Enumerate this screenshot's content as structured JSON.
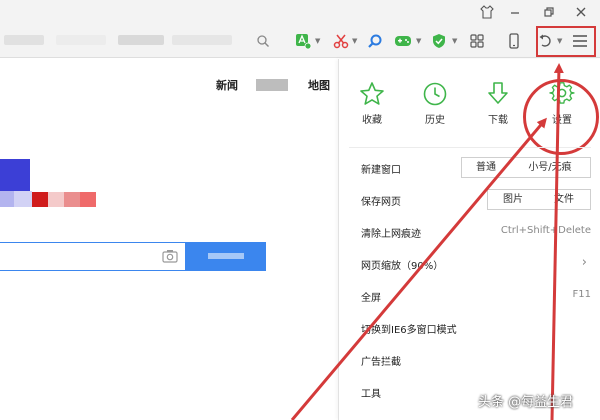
{
  "page": {
    "nav": [
      "新闻",
      "地图"
    ]
  },
  "menu": {
    "quick": [
      {
        "label": "收藏",
        "icon": "star-icon"
      },
      {
        "label": "历史",
        "icon": "clock-icon"
      },
      {
        "label": "下载",
        "icon": "download-icon"
      },
      {
        "label": "设置",
        "icon": "gear-icon"
      }
    ],
    "new_window": {
      "label": "新建窗口",
      "opt1": "普通",
      "opt2": "小号/无痕"
    },
    "save_page": {
      "label": "保存网页",
      "opt1": "图片",
      "opt2": "文件"
    },
    "clear_traces": {
      "label": "清除上网痕迹",
      "shortcut": "Ctrl+Shift+Delete"
    },
    "zoom": {
      "label": "网页缩放（90%）"
    },
    "fullscreen": {
      "label": "全屏",
      "shortcut": "F11"
    },
    "ie6_mode": {
      "label": "切换到IE6多窗口模式"
    },
    "adblock": {
      "label": "广告拦截"
    },
    "tools": {
      "label": "工具"
    }
  },
  "watermark": "头条 @每益生君",
  "colors": {
    "accent_green": "#3fb54a",
    "highlight_red": "#d43a3a",
    "search_blue": "#3b86ee"
  }
}
